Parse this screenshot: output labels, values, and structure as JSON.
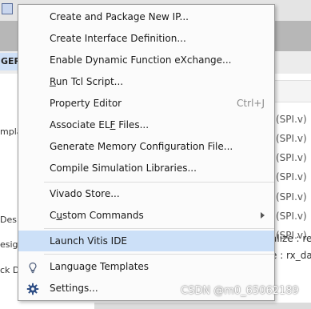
{
  "background": {
    "left_panel_header": "GER",
    "left_fragments": [
      "mpla",
      "Des",
      "esig",
      "ck D"
    ],
    "right_code": [
      "(SPI.v)",
      "(SPI.v)",
      "(SPI.v)",
      "(SPI.v)",
      "(SPI.v)",
      "(SPI.v)",
      "(SPI.v)"
    ],
    "right_lines": [
      "alize : reg",
      "e : rx_data"
    ]
  },
  "menu": {
    "items": [
      {
        "label": "Create and Package New IP...",
        "shortcut": "",
        "underline": ""
      },
      {
        "label": "Create Interface Definition...",
        "shortcut": "",
        "underline": ""
      },
      {
        "label": "Enable Dynamic Function eXchange...",
        "shortcut": "",
        "underline": ""
      },
      {
        "label_pre": "",
        "label_u": "R",
        "label_post": "un Tcl Script...",
        "shortcut": ""
      },
      {
        "label": "Property Editor",
        "shortcut": "Ctrl+J"
      },
      {
        "label_pre": "Associate EL",
        "label_u": "F",
        "label_post": " Files...",
        "shortcut": ""
      },
      {
        "label": "Generate Memory Configuration File...",
        "shortcut": ""
      },
      {
        "label": "Compile Simulation Libraries...",
        "shortcut": ""
      },
      {
        "label": "Vivado Store...",
        "shortcut": ""
      },
      {
        "label_pre": "C",
        "label_u": "u",
        "label_post": "stom Commands",
        "shortcut": ""
      },
      {
        "label": "Launch Vitis IDE",
        "shortcut": ""
      },
      {
        "label": "Language Templates",
        "shortcut": ""
      },
      {
        "label": "Settings...",
        "shortcut": ""
      }
    ]
  },
  "watermark": "CSDN @m0_65062189",
  "colors": {
    "highlight": "#cce0f8",
    "menu_bg": "#fbfbfb"
  }
}
